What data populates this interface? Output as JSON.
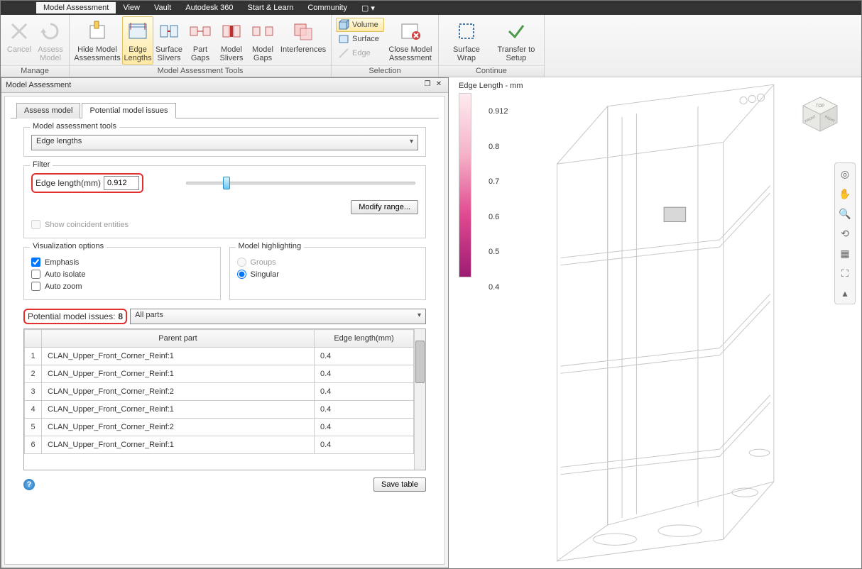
{
  "menu": {
    "items": [
      "Model Assessment",
      "View",
      "Vault",
      "Autodesk 360",
      "Start & Learn",
      "Community",
      "▢ ▾"
    ],
    "active": 0
  },
  "ribbon": {
    "groups": [
      {
        "label": "Manage",
        "buttons": [
          {
            "icon": "cancel-icon",
            "label": "Cancel",
            "disabled": true
          },
          {
            "icon": "assess-icon",
            "label": "Assess Model",
            "disabled": true
          }
        ]
      },
      {
        "label": "Model Assessment Tools",
        "buttons": [
          {
            "icon": "hide-icon",
            "label": "Hide Model Assessments",
            "wide": true
          },
          {
            "icon": "edge-lengths-icon",
            "label": "Edge Lengths",
            "active": true
          },
          {
            "icon": "surface-slivers-icon",
            "label": "Surface Slivers"
          },
          {
            "icon": "part-gaps-icon",
            "label": "Part Gaps"
          },
          {
            "icon": "model-slivers-icon",
            "label": "Model Slivers"
          },
          {
            "icon": "model-gaps-icon",
            "label": "Model Gaps"
          },
          {
            "icon": "interferences-icon",
            "label": "Interferences",
            "wide": true
          }
        ]
      },
      {
        "label": "Selection",
        "mini": [
          {
            "icon": "volume-icon",
            "label": "Volume",
            "active": true
          },
          {
            "icon": "surface-icon",
            "label": "Surface"
          },
          {
            "icon": "edge-icon",
            "label": "Edge",
            "disabled": true
          }
        ],
        "buttons": [
          {
            "icon": "close-assess-icon",
            "label": "Close Model Assessment",
            "wide": true
          }
        ]
      },
      {
        "label": "Continue",
        "buttons": [
          {
            "icon": "surface-wrap-icon",
            "label": "Surface Wrap",
            "wide": true
          },
          {
            "icon": "transfer-icon",
            "label": "Transfer to Setup",
            "wide": true
          }
        ]
      }
    ]
  },
  "panel": {
    "title": "Model Assessment",
    "tabs": [
      "Assess model",
      "Potential model issues"
    ],
    "active_tab": 1,
    "tools_label": "Model assessment tools",
    "tools_value": "Edge lengths",
    "filter_label": "Filter",
    "filter_field_label": "Edge length(mm)",
    "filter_value": "0.912",
    "modify_btn": "Modify range...",
    "coincident": "Show coincident entities",
    "viz_label": "Visualization options",
    "viz_opts": [
      {
        "label": "Emphasis",
        "checked": true
      },
      {
        "label": "Auto isolate",
        "checked": false
      },
      {
        "label": "Auto zoom",
        "checked": false
      }
    ],
    "hl_label": "Model highlighting",
    "hl_opts": [
      {
        "label": "Groups",
        "checked": false
      },
      {
        "label": "Singular",
        "checked": true
      }
    ],
    "issues_label": "Potential model issues:",
    "issues_count": "8",
    "issues_filter": "All parts",
    "table": {
      "headers": [
        "",
        "Parent part",
        "Edge length(mm)"
      ],
      "rows": [
        [
          "1",
          "CLAN_Upper_Front_Corner_Reinf:1",
          "0.4"
        ],
        [
          "2",
          "CLAN_Upper_Front_Corner_Reinf:1",
          "0.4"
        ],
        [
          "3",
          "CLAN_Upper_Front_Corner_Reinf:2",
          "0.4"
        ],
        [
          "4",
          "CLAN_Upper_Front_Corner_Reinf:1",
          "0.4"
        ],
        [
          "5",
          "CLAN_Upper_Front_Corner_Reinf:2",
          "0.4"
        ],
        [
          "6",
          "CLAN_Upper_Front_Corner_Reinf:1",
          "0.4"
        ]
      ]
    },
    "save_btn": "Save table"
  },
  "legend": {
    "title": "Edge Length - mm",
    "ticks": [
      "0.912",
      "0.8",
      "0.7",
      "0.6",
      "0.5",
      "0.4"
    ]
  },
  "viewcube": {
    "top": "TOP",
    "front": "FRONT",
    "right": "RIGHT"
  }
}
